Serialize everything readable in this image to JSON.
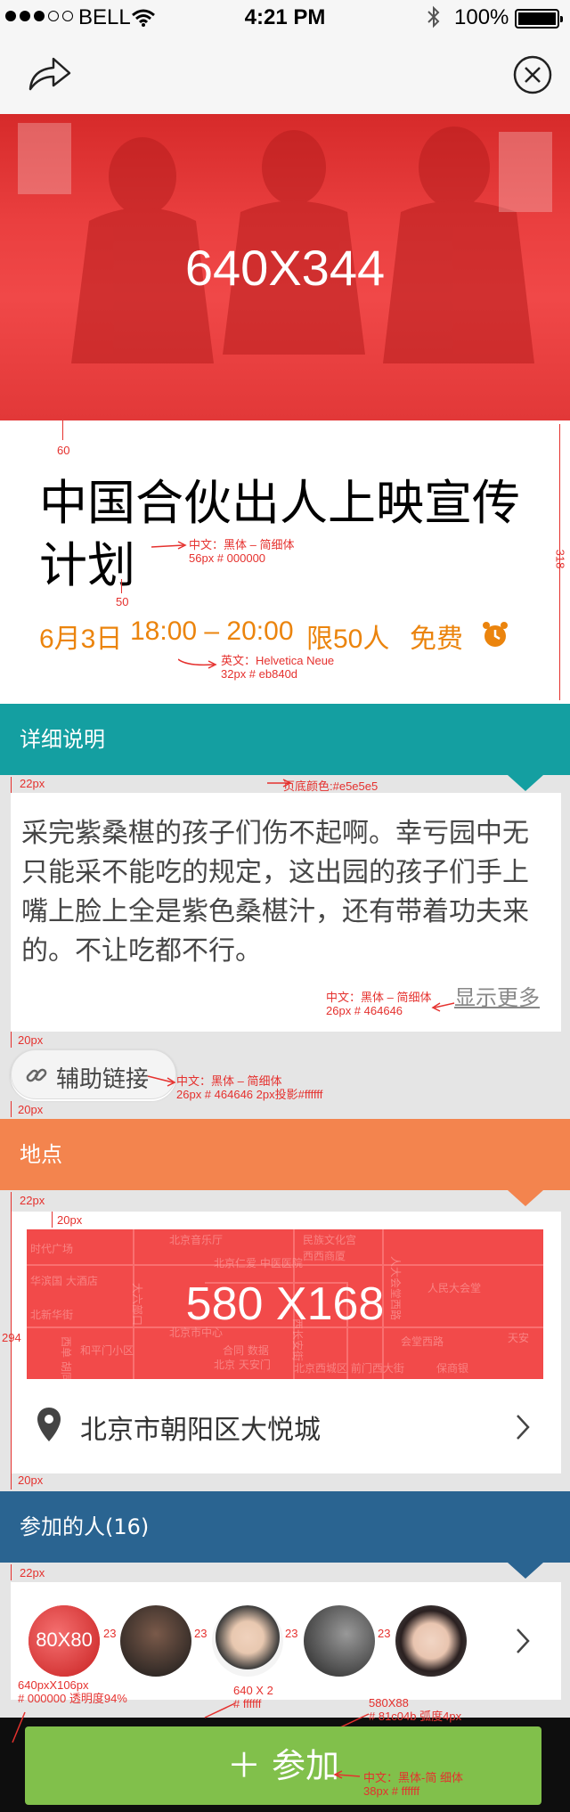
{
  "status_bar": {
    "carrier": "BELL",
    "time": "4:21 PM",
    "battery": "100%"
  },
  "hero": {
    "label": "640X344"
  },
  "event": {
    "title": "中国合伙出人上映宣传计划",
    "date": "6月3日",
    "time_range": "18:00 – 20:00",
    "limit": "限50人",
    "price": "免费"
  },
  "annotations": {
    "spacing_60": "60",
    "title_spec_line1": "中文：黑体 – 简细体",
    "title_spec_line2": "56px   # 000000",
    "spacing_50": "50",
    "info_height": "318",
    "dt_spec_line1": "英文：Helvetica Neue",
    "dt_spec_line2": "32px   # eb840d",
    "desc_gap": "22px",
    "page_bg": "页底颜色:#e5e5e5",
    "desc_spec_line1": "中文：黑体 – 简细体",
    "desc_spec_line2": "26px   # 464646",
    "gap_20a": "20px",
    "link_spec_line1": "中文：黑体 – 简细体",
    "link_spec_line2": "26px   # 464646   2px投影#ffffff",
    "gap_20b": "20px",
    "loc_gap": "22px",
    "map_inset": "20px",
    "loc_height": "294",
    "loc_bottom": "20px",
    "people_gap": "22px",
    "av_gap_1": "23",
    "av_gap_2": "23",
    "av_gap_3": "23",
    "av_gap_4": "23",
    "bottom_bar_1": "640pxX106px",
    "bottom_bar_2": "# 000000  透明度94%",
    "divider_1": "640 X 2",
    "divider_2": "# ffffff",
    "join_spec_1": "580X88",
    "join_spec_2": "# 81c04b   弧度4px",
    "join_font_1": "中文：黑体-简  细体",
    "join_font_2": "38px    # ffffff"
  },
  "details": {
    "header": "详细说明",
    "text": "采完紫桑椹的孩子们伤不起啊。幸亏园中无只能采不能吃的规定，这出园的孩子们手上嘴上脸上全是紫色桑椹汁，还有带着功夫来的。不让吃都不行。",
    "more_label": "显示更多",
    "link_label": "辅助链接"
  },
  "location": {
    "header": "地点",
    "map_label": "580 X168",
    "address": "北京市朝阳区大悦城",
    "map_streets": [
      "北京音乐厅",
      "北京仁爱 中医医院",
      "民族文化宫",
      "西西商厦",
      "大六部口",
      "人大会堂西路",
      "人民大会堂",
      "时代广场",
      "华滨国 大酒店",
      "北京市中心",
      "合同 数据",
      "会堂西路",
      "天安",
      "北京 天安门",
      "西长安街",
      "和平门小区",
      "西单 胡同",
      "保商银",
      "北新华街",
      "北京西城区 前门西大街"
    ]
  },
  "participants": {
    "header": "参加的人(16)",
    "first_avatar_label": "80X80"
  },
  "join": {
    "label": "＋ 参加"
  },
  "colors": {
    "accent_orange": "#eb840d",
    "details_header": "#149fa1",
    "location_header": "#f3844e",
    "participants_header": "#2a6491",
    "join_button": "#81c04b",
    "annotation": "#e5312e"
  }
}
